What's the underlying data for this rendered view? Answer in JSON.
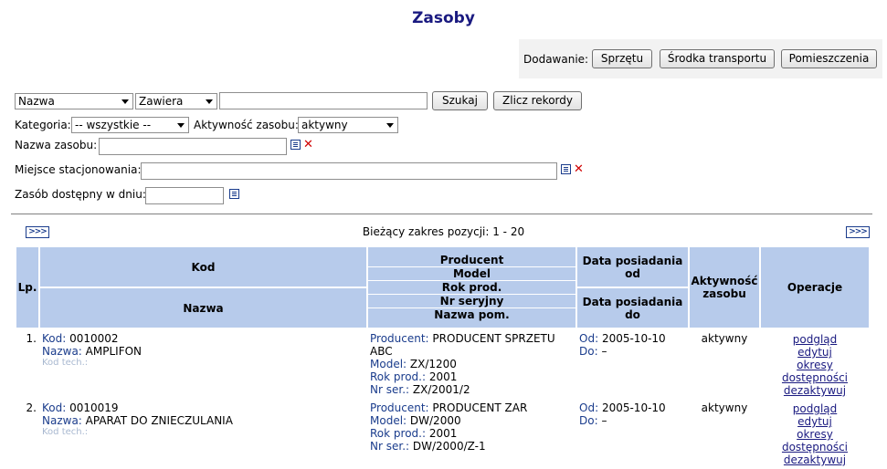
{
  "page_title": "Zasoby",
  "adding": {
    "label": "Dodawanie:",
    "buttons": [
      "Sprzętu",
      "Środka transportu",
      "Pomieszczenia"
    ]
  },
  "search": {
    "field_select": "Nazwa",
    "operator_select": "Zawiera",
    "value": "",
    "search_button": "Szukaj",
    "count_button": "Zlicz rekordy"
  },
  "filters": {
    "category_label": "Kategoria:",
    "category_value": "-- wszystkie --",
    "activity_label": "Aktywność zasobu:",
    "activity_value": "aktywny",
    "name_label": "Nazwa zasobu:",
    "name_value": "",
    "location_label": "Miejsce stacjonowania:",
    "location_value": "",
    "available_label": "Zasób dostępny w dniu:",
    "available_value": ""
  },
  "pagination": {
    "prev_label": ">>>",
    "next_label": ">>>",
    "range_text": "Bieżący zakres pozycji: 1 - 20"
  },
  "table": {
    "headers": {
      "lp": "Lp.",
      "kod": "Kod",
      "nazwa": "Nazwa",
      "producent": "Producent",
      "model": "Model",
      "rok": "Rok prod.",
      "nr": "Nr seryjny",
      "nazwa_pom": "Nazwa pom.",
      "data_od": "Data posiadania od",
      "data_do": "Data posiadania do",
      "aktywnosc": "Aktywność zasobu",
      "operacje": "Operacje"
    },
    "field_labels": {
      "kod": "Kod:",
      "nazwa": "Nazwa:",
      "kod_tech": "Kod tech.:",
      "producent": "Producent:",
      "model": "Model:",
      "rok": "Rok prod.:",
      "nr_ser": "Nr ser.:",
      "od": "Od:",
      "do": "Do:"
    },
    "operations": [
      "podgląd",
      "edytuj",
      "okresy dostępności",
      "dezaktywuj"
    ],
    "rows": [
      {
        "lp": "1.",
        "kod": "0010002",
        "nazwa": "AMPLIFON",
        "kod_tech": "",
        "producent": "PRODUCENT SPRZETU ABC",
        "model": "ZX/1200",
        "rok": "2001",
        "nr_ser": "ZX/2001/2",
        "od": "2005-10-10",
        "do": "–",
        "aktywnosc": "aktywny"
      },
      {
        "lp": "2.",
        "kod": "0010019",
        "nazwa": "APARAT DO ZNIECZULANIA",
        "kod_tech": "",
        "producent": "PRODUCENT ZAR",
        "model": "DW/2000",
        "rok": "2001",
        "nr_ser": "DW/2000/Z-1",
        "od": "2005-10-10",
        "do": "–",
        "aktywnosc": "aktywny"
      }
    ]
  }
}
